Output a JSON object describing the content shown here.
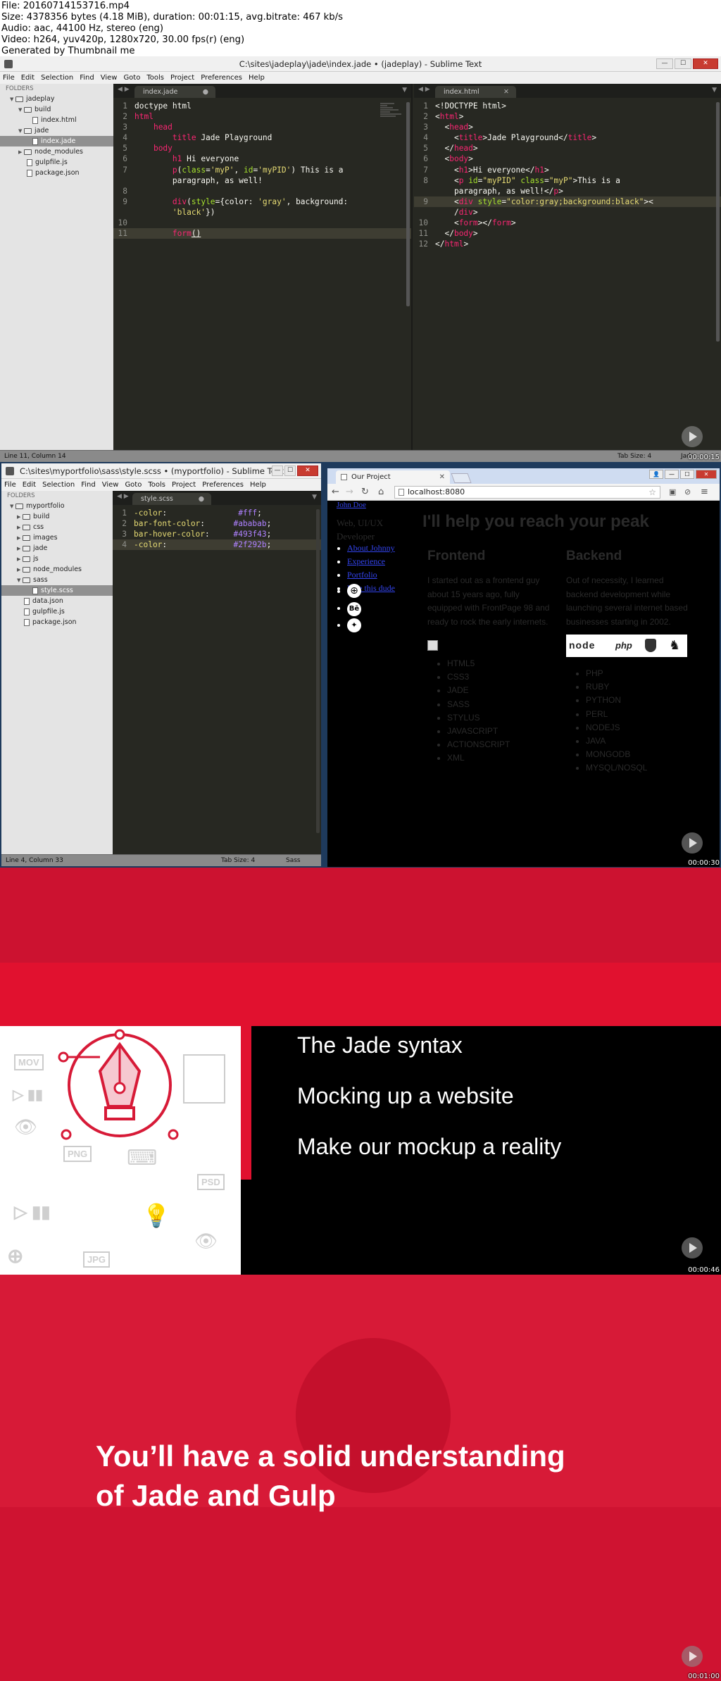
{
  "meta": {
    "file": "File: 20160714153716.mp4",
    "size": "Size: 4378356 bytes (4.18 MiB), duration: 00:01:15, avg.bitrate: 467 kb/s",
    "audio": "Audio: aac, 44100 Hz, stereo (eng)",
    "video": "Video: h264, yuv420p, 1280x720, 30.00 fps(r) (eng)",
    "generated": "Generated by Thumbnail me"
  },
  "frame1": {
    "title": "C:\\sites\\jadeplay\\jade\\index.jade • (jadeplay) - Sublime Text",
    "menu": [
      "File",
      "Edit",
      "Selection",
      "Find",
      "View",
      "Goto",
      "Tools",
      "Project",
      "Preferences",
      "Help"
    ],
    "sidebar": {
      "header": "FOLDERS",
      "items": [
        "jadeplay",
        "build",
        "index.html",
        "jade",
        "index.jade",
        "node_modules",
        "gulpfile.js",
        "package.json"
      ]
    },
    "tab_left": "index.jade",
    "tab_right": "index.html",
    "status_left": "Line 11, Column 14",
    "status_tab": "Tab Size: 4",
    "status_syntax": "Jade",
    "timestamp": "00:00:15"
  },
  "frame2": {
    "title": "C:\\sites\\myportfolio\\sass\\style.scss • (myportfolio) - Sublime Text",
    "menu": [
      "File",
      "Edit",
      "Selection",
      "Find",
      "View",
      "Goto",
      "Tools",
      "Project",
      "Preferences",
      "Help"
    ],
    "sidebar": {
      "header": "FOLDERS",
      "items": [
        "myportfolio",
        "build",
        "css",
        "images",
        "jade",
        "js",
        "node_modules",
        "sass",
        "style.scss",
        "data.json",
        "gulpfile.js",
        "package.json"
      ]
    },
    "tab": "style.scss",
    "status_left": "Line 4, Column 33",
    "status_tab": "Tab Size: 4",
    "status_syntax": "Sass",
    "browser": {
      "tab_title": "Our Project",
      "url": "localhost:8080",
      "link_top": "John Doe",
      "role": "Web, UI/UX Developer",
      "nav": [
        "About Johnny",
        "Experience",
        "Portfolio",
        "Hire this dude"
      ],
      "heading": "I'll help you reach your peak",
      "frontend_title": "Frontend",
      "frontend_text": "I started out as a frontend guy about 15 years ago, fully equipped with FrontPage 98 and ready to rock the early internets.",
      "frontend_list": [
        "HTML5",
        "CSS3",
        "JADE",
        "SASS",
        "STYLUS",
        "JAVASCRIPT",
        "ACTIONSCRIPT",
        "XML"
      ],
      "backend_title": "Backend",
      "backend_text": "Out of necessity, I learned backend development while launching several internet based businesses starting in 2002.",
      "backend_list": [
        "PHP",
        "RUBY",
        "PYTHON",
        "PERL",
        "NODEJS",
        "JAVA",
        "MONGODB",
        "MYSQL/NOSQL"
      ],
      "logos": [
        "node",
        "php"
      ]
    },
    "timestamp": "00:00:30"
  },
  "frame3": {
    "items": [
      "The Jade syntax",
      "Mocking up a website",
      "Make our mockup a reality"
    ],
    "icon_labels": [
      "MOV",
      "PNG",
      "PSD",
      "JPG"
    ],
    "timestamp": "00:00:46"
  },
  "frame4": {
    "line1": "You’ll have a solid understanding",
    "line2": "of Jade and Gulp",
    "timestamp": "00:01:00"
  }
}
